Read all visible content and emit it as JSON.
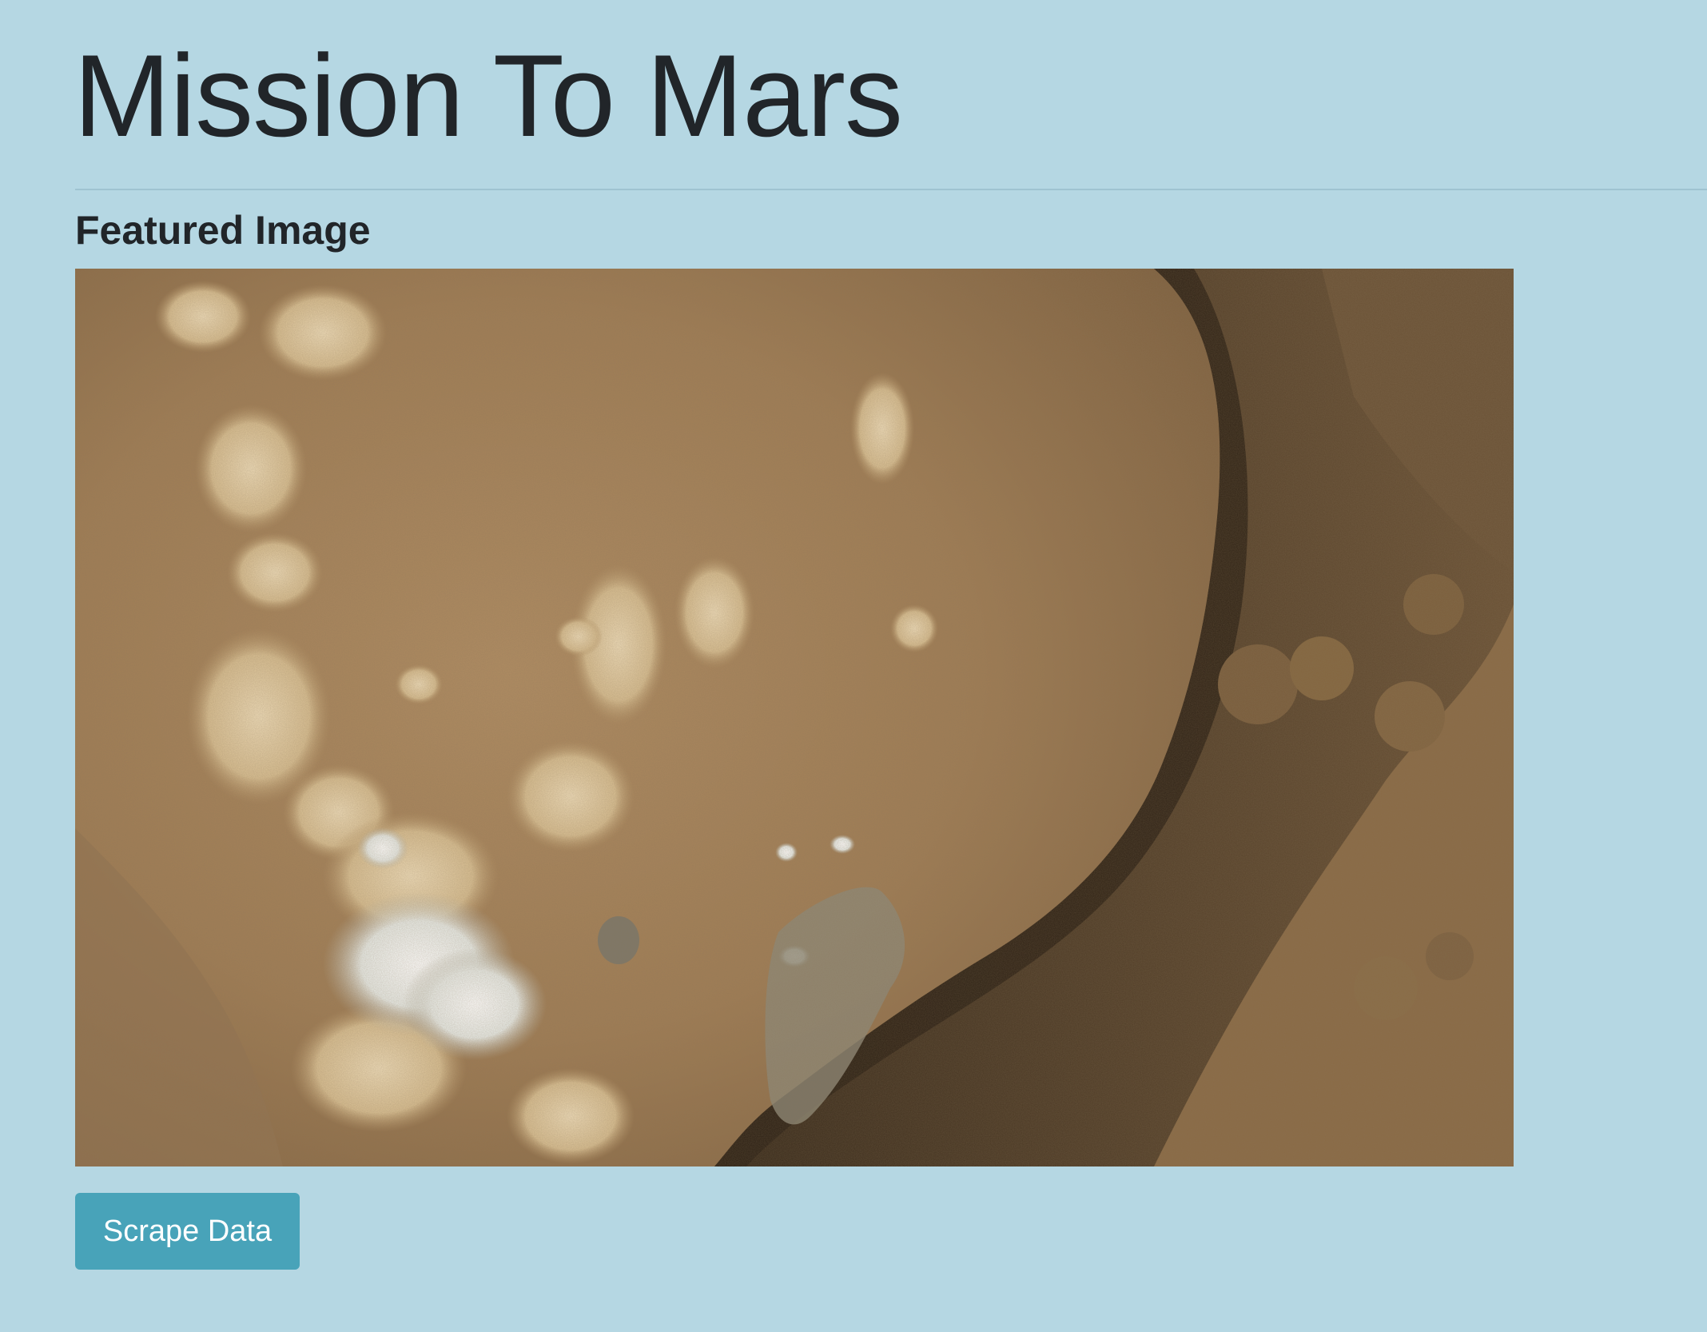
{
  "header": {
    "title": "Mission To Mars"
  },
  "featured": {
    "heading": "Featured Image",
    "image_alt": "Mars rock surface close-up"
  },
  "actions": {
    "scrape_label": "Scrape Data"
  },
  "colors": {
    "background": "#b5d7e3",
    "button": "#48a3b9",
    "text": "#212529",
    "rock_base": "#a07d55",
    "rock_shadow": "#3a2c1c",
    "mineral_light": "#e8d6b0"
  }
}
